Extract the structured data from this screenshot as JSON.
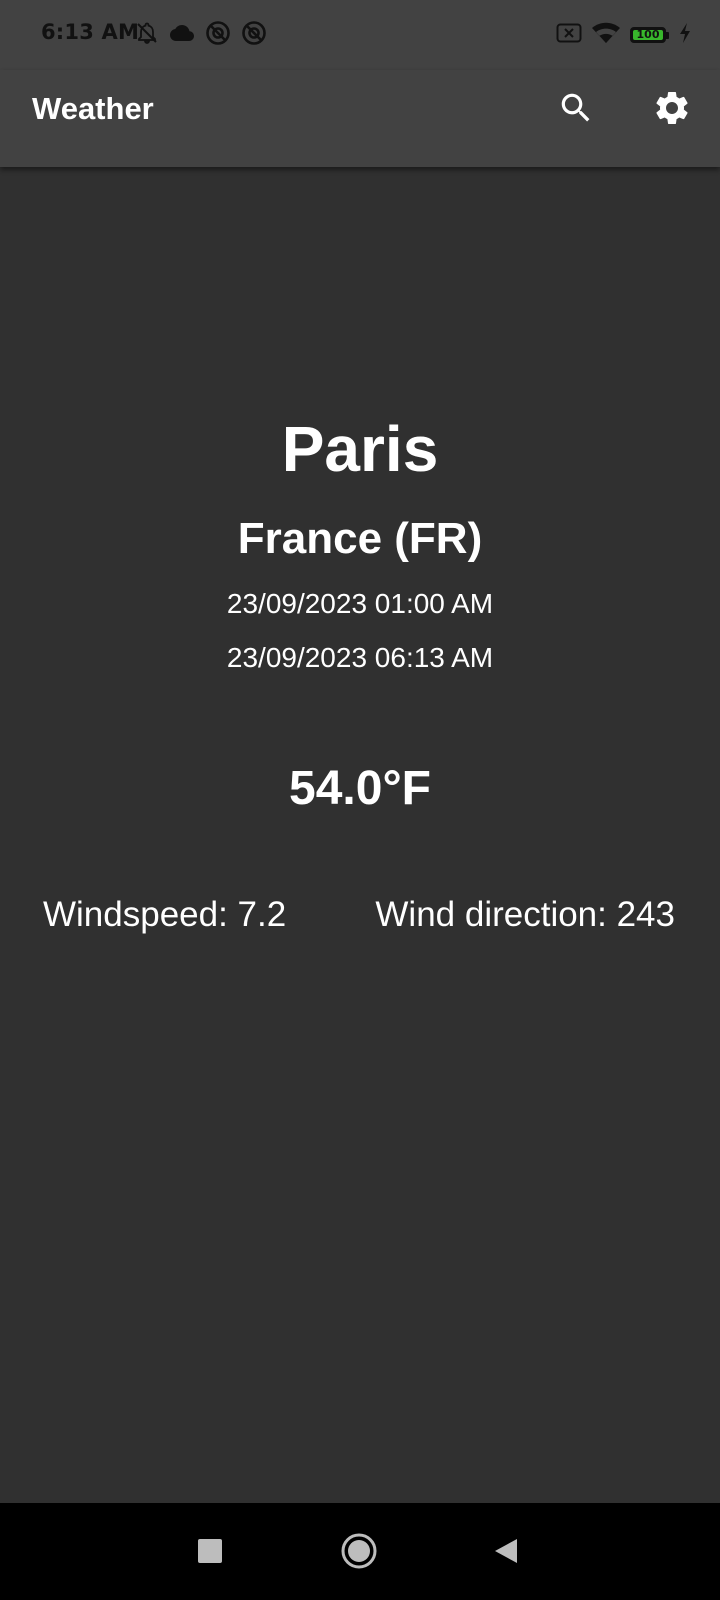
{
  "status_bar": {
    "time": "6:13 AM",
    "battery_level": "100",
    "icons_left": [
      "bell-off-icon",
      "cloud-icon",
      "circle-at-icon",
      "circle-at-icon"
    ],
    "icons_right": [
      "sim-off-icon",
      "wifi-icon",
      "battery-icon",
      "charging-bolt-icon"
    ]
  },
  "app_bar": {
    "title": "Weather",
    "actions": [
      "search-icon",
      "settings-icon"
    ]
  },
  "weather": {
    "city": "Paris",
    "country": "France (FR)",
    "local_time": "23/09/2023 01:00 AM",
    "updated_time": "23/09/2023 06:13 AM",
    "temperature": "54.0°F",
    "windspeed": "Windspeed: 7.2",
    "wind_direction": "Wind direction: 243"
  },
  "navigation": {
    "buttons": [
      "recents-icon",
      "home-icon",
      "back-icon"
    ]
  },
  "colors": {
    "app_bar_bg": "#424242",
    "content_bg": "#303030",
    "nav_bar_bg": "#000000",
    "battery_fill": "#38b72c",
    "text": "#ffffff"
  }
}
